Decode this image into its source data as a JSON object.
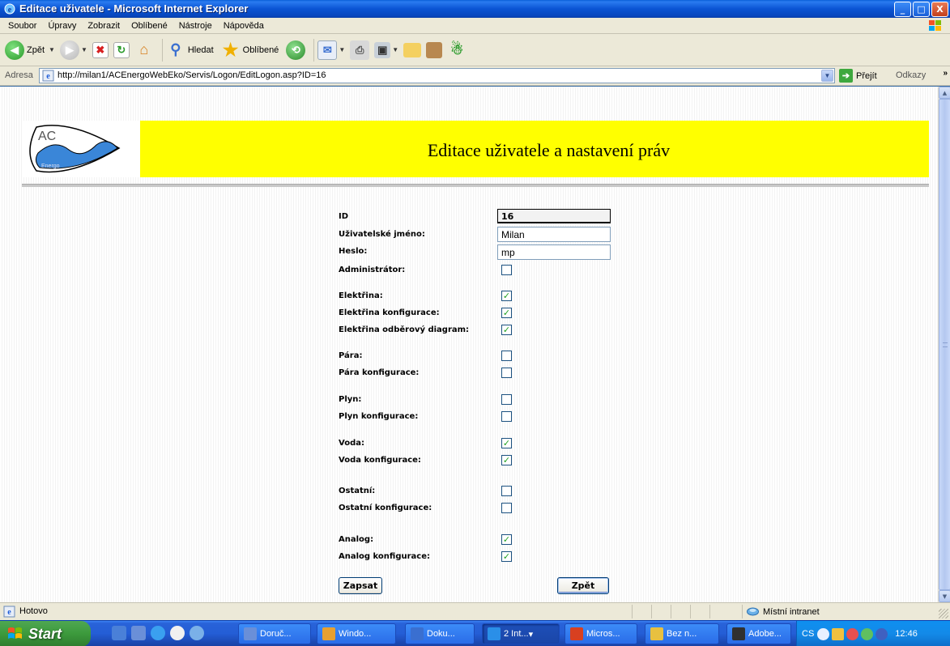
{
  "window": {
    "title": "Editace uživatele - Microsoft Internet Explorer",
    "buttons": [
      "_",
      "□",
      "X"
    ]
  },
  "menu": [
    "Soubor",
    "Úpravy",
    "Zobrazit",
    "Oblíbené",
    "Nástroje",
    "Nápověda"
  ],
  "toolbar": {
    "back_label": "Zpět",
    "search_label": "Hledat",
    "favorites_label": "Oblíbené"
  },
  "address": {
    "label": "Adresa",
    "url": "http://milan1/ACEnergoWebEko/Servis/Logon/EditLogon.asp?ID=16",
    "go_label": "Přejít",
    "links_label": "Odkazy",
    "more": "»"
  },
  "page": {
    "logo_text": "AC",
    "logo_sub": "Energo",
    "banner_title": "Editace uživatele a nastavení práv",
    "fields": {
      "id_label": "ID",
      "id_value": "16",
      "username_label": "Uživatelské jméno:",
      "username_value": "Milan",
      "password_label": "Heslo:",
      "password_value": "mp"
    },
    "permissions": [
      {
        "label": "Administrátor:",
        "checked": false
      },
      {
        "label": "Elektřina:",
        "checked": true
      },
      {
        "label": "Elektřina konfigurace:",
        "checked": true
      },
      {
        "label": "Elektřina odběrový diagram:",
        "checked": true
      },
      {
        "label": "Pára:",
        "checked": false
      },
      {
        "label": "Pára konfigurace:",
        "checked": false
      },
      {
        "label": "Plyn:",
        "checked": false
      },
      {
        "label": "Plyn konfigurace:",
        "checked": false
      },
      {
        "label": "Voda:",
        "checked": true
      },
      {
        "label": "Voda konfigurace:",
        "checked": true
      },
      {
        "label": "Ostatní:",
        "checked": false
      },
      {
        "label": "Ostatní konfigurace:",
        "checked": false
      },
      {
        "label": "Analog:",
        "checked": true
      },
      {
        "label": "Analog konfigurace:",
        "checked": true
      }
    ],
    "save_label": "Zapsat",
    "back_label": "Zpět"
  },
  "status": {
    "text": "Hotovo",
    "zone": "Místní intranet"
  },
  "taskbar": {
    "start_label": "Start",
    "tasks": [
      {
        "label": "Doruč...",
        "icon_color": "#6a8fd8",
        "active": false
      },
      {
        "label": "Windo...",
        "icon_color": "#e8a030",
        "active": false
      },
      {
        "label": "Doku...",
        "icon_color": "#3a6fd0",
        "active": false
      },
      {
        "label": "2 Int...",
        "icon_color": "#2a8fe8",
        "active": true
      },
      {
        "label": "Micros...",
        "icon_color": "#d84020",
        "active": false
      },
      {
        "label": "Bez n...",
        "icon_color": "#e8c040",
        "active": false
      },
      {
        "label": "Adobe...",
        "icon_color": "#303030",
        "active": false
      }
    ],
    "lang": "CS",
    "clock": "12:46"
  },
  "colors": {
    "banner_yellow": "#ffff00",
    "checkmark": "#21a121",
    "xp_blue": "#245ed6",
    "start_green": "#3c9a3c"
  }
}
